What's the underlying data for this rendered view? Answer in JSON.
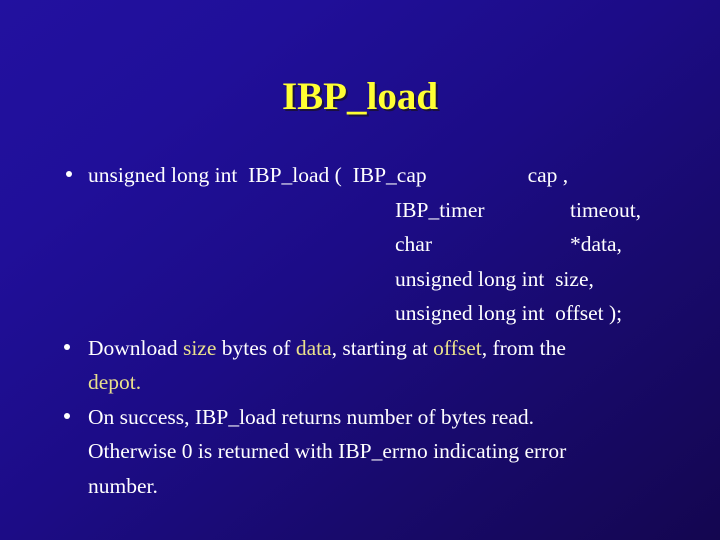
{
  "slide": {
    "title": "IBP_load",
    "colors": {
      "background_top_left": "#22119f",
      "background_bottom_right": "#140650",
      "title": "#ffff33",
      "title_shadow": "#1a1040",
      "body_text": "#ffffff",
      "highlight": "#e9e08c"
    },
    "bullets": [
      {
        "id": "signature",
        "marker": "•",
        "signature": {
          "return_type": "unsigned long int",
          "function_name": "IBP_load",
          "open_paren": "(",
          "first_param_type": "IBP_cap",
          "first_param_name": "cap ,",
          "params": [
            {
              "type": "IBP_timer",
              "name": "timeout,"
            },
            {
              "type": "char",
              "name": "*data,"
            },
            {
              "type": "unsigned long int",
              "name": "size,"
            },
            {
              "type": "unsigned long int",
              "name": "offset );"
            }
          ]
        }
      },
      {
        "id": "description",
        "marker": "•",
        "segments": [
          {
            "text": "Download ",
            "style": "plain"
          },
          {
            "text": "size",
            "style": "highlight"
          },
          {
            "text": " bytes of ",
            "style": "plain"
          },
          {
            "text": "data",
            "style": "highlight"
          },
          {
            "text": ", starting at ",
            "style": "plain"
          },
          {
            "text": "offset",
            "style": "highlight"
          },
          {
            "text": ", from the",
            "style": "plain"
          }
        ],
        "second_line": "depot."
      },
      {
        "id": "return-value",
        "marker": "•",
        "line1": "On success, IBP_load returns number of bytes read.",
        "line2": "Otherwise 0 is returned with IBP_errno indicating error",
        "line3": "number."
      }
    ]
  }
}
